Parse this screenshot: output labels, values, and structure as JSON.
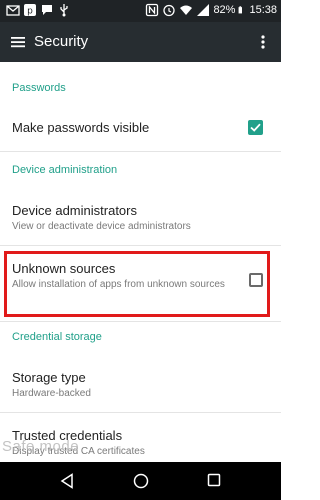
{
  "status_bar": {
    "battery": "82%",
    "time": "15:38",
    "left_icons": [
      "envelope-icon",
      "pocket-icon",
      "chat-icon",
      "usb-icon"
    ],
    "right_icons": [
      "nfc-icon",
      "alarm-icon",
      "wifi-icon",
      "signal-icon",
      "battery-icon"
    ]
  },
  "app_bar": {
    "title": "Security",
    "menu_icon": "hamburger-menu-icon",
    "overflow_icon": "more-vert-icon"
  },
  "sections": {
    "passwords": {
      "header": "Passwords",
      "make_visible_label": "Make passwords visible",
      "make_visible_checked": true
    },
    "device_admin": {
      "header": "Device administration",
      "admins_title": "Device administrators",
      "admins_sub": "View or deactivate device administrators",
      "unknown_title": "Unknown sources",
      "unknown_sub": "Allow installation of apps from unknown sources",
      "unknown_checked": false
    },
    "credential_storage": {
      "header": "Credential storage",
      "storage_type_title": "Storage type",
      "storage_type_sub": "Hardware-backed",
      "trusted_title": "Trusted credentials",
      "trusted_sub": "Display trusted CA certificates"
    }
  },
  "overlay": {
    "safe_mode": "Safe mode"
  },
  "colors": {
    "accent": "#21a08a",
    "highlight": "#e11a1a",
    "app_bar": "#272d31"
  },
  "nav_bar": {
    "icons": [
      "back-icon",
      "home-icon",
      "recents-icon"
    ]
  }
}
